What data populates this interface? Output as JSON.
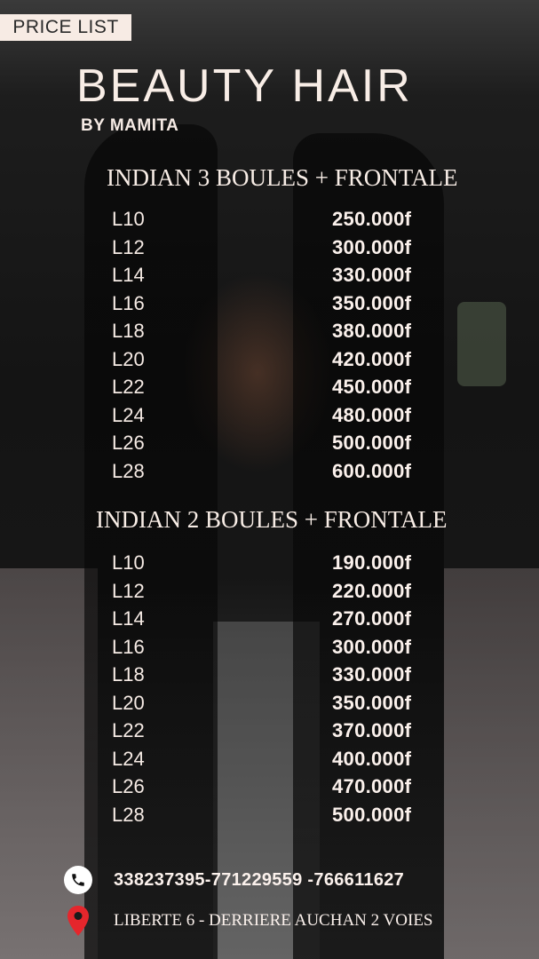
{
  "header": {
    "tag": "PRICE LIST",
    "brand": "BEAUTY HAIR",
    "byline": "BY MAMITA"
  },
  "sections": [
    {
      "title": "INDIAN 3 BOULES + FRONTALE",
      "items": [
        {
          "length": "L10",
          "price": "250.000f"
        },
        {
          "length": "L12",
          "price": "300.000f"
        },
        {
          "length": "L14",
          "price": "330.000f"
        },
        {
          "length": "L16",
          "price": "350.000f"
        },
        {
          "length": "L18",
          "price": "380.000f"
        },
        {
          "length": "L20",
          "price": "420.000f"
        },
        {
          "length": "L22",
          "price": "450.000f"
        },
        {
          "length": "L24",
          "price": "480.000f"
        },
        {
          "length": "L26",
          "price": "500.000f"
        },
        {
          "length": "L28",
          "price": "600.000f"
        }
      ]
    },
    {
      "title": "INDIAN 2 BOULES + FRONTALE",
      "items": [
        {
          "length": "L10",
          "price": "190.000f"
        },
        {
          "length": "L12",
          "price": "220.000f"
        },
        {
          "length": "L14",
          "price": "270.000f"
        },
        {
          "length": "L16",
          "price": "300.000f"
        },
        {
          "length": "L18",
          "price": "330.000f"
        },
        {
          "length": "L20",
          "price": "350.000f"
        },
        {
          "length": "L22",
          "price": "370.000f"
        },
        {
          "length": "L24",
          "price": "400.000f"
        },
        {
          "length": "L26",
          "price": "470.000f"
        },
        {
          "length": "L28",
          "price": "500.000f"
        }
      ]
    }
  ],
  "contact": {
    "phone_icon": "phone-icon",
    "phones": "338237395-771229559 -766611627",
    "location_icon": "map-pin-icon",
    "address": "LIBERTE 6 - DERRIERE AUCHAN 2 VOIES"
  },
  "colors": {
    "text": "#f8ede6",
    "tag_background": "#f7ebe4",
    "pin": "#e5262c"
  }
}
